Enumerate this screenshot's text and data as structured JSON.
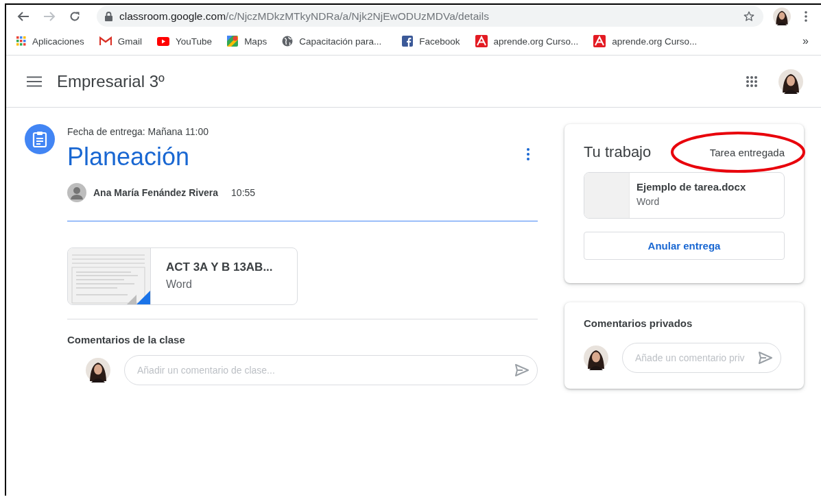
{
  "browser": {
    "url": {
      "host": "classroom.google.com",
      "path": "/c/NjczMDkzMTkyNDRa/a/Njk2NjEwODUzMDVa/details"
    },
    "bookmarks": [
      {
        "kind": "apps",
        "label": "Aplicaciones"
      },
      {
        "kind": "gmail",
        "label": "Gmail"
      },
      {
        "kind": "youtube",
        "label": "YouTube"
      },
      {
        "kind": "maps",
        "label": "Maps"
      },
      {
        "kind": "globe",
        "label": "Capacitación para..."
      },
      {
        "kind": "facebook",
        "label": "Facebook"
      },
      {
        "kind": "aprende",
        "label": "aprende.org Curso..."
      },
      {
        "kind": "aprende",
        "label": "aprende.org Curso..."
      }
    ],
    "overflow": "»"
  },
  "header": {
    "title": "Empresarial 3º"
  },
  "assignment": {
    "due": "Fecha de entrega: Mañana 11:00",
    "title": "Planeación",
    "author": "Ana María Fenández Rivera",
    "time": "10:55",
    "attachment": {
      "name": "ACT 3A Y B 13AB...",
      "type": "Word"
    }
  },
  "class_comments": {
    "heading": "Comentarios de la clase",
    "placeholder": "Añadir un comentario de clase..."
  },
  "your_work": {
    "heading": "Tu trabajo",
    "status": "Tarea entregada",
    "file": {
      "name": "Ejemplo de tarea.docx",
      "type": "Word"
    },
    "button": "Anular entrega"
  },
  "private_comments": {
    "heading": "Comentarios privados",
    "placeholder": "Añade un comentario priv"
  }
}
